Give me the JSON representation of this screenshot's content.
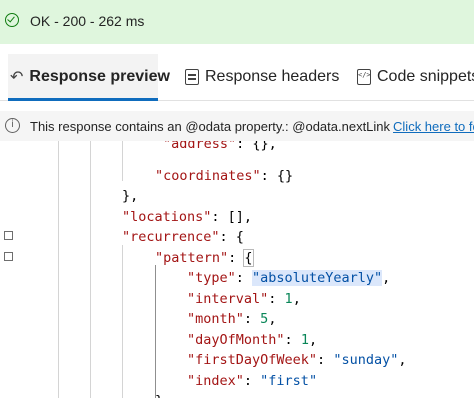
{
  "status": {
    "text": "OK - 200 - 262 ms",
    "color": "#dff6dd"
  },
  "tabs": [
    {
      "label": "Response preview",
      "icon": "undo-arrow-icon",
      "active": true
    },
    {
      "label": "Response headers",
      "icon": "headers-icon",
      "active": false
    },
    {
      "label": "Code snippets",
      "icon": "code-snippet-icon",
      "active": false
    }
  ],
  "info": {
    "text": "This response contains an @odata property.: @odata.nextLink",
    "link": "Click here to fo"
  },
  "code": {
    "l1": [
      "\"address\"",
      ": {},"
    ],
    "l2": [
      "\"coordinates\"",
      ": {}"
    ],
    "l3": "},",
    "l4": [
      "\"locations\"",
      ": [],"
    ],
    "l5": [
      "\"recurrence\"",
      ": {"
    ],
    "l6": [
      "\"pattern\"",
      ": {"
    ],
    "l7": [
      "\"type\"",
      ": ",
      "\"absoluteYearly\"",
      ","
    ],
    "l8": [
      "\"interval\"",
      ": ",
      "1",
      ","
    ],
    "l9": [
      "\"month\"",
      ": ",
      "5",
      ","
    ],
    "l10": [
      "\"dayOfMonth\"",
      ": ",
      "1",
      ","
    ],
    "l11": [
      "\"firstDayOfWeek\"",
      ": ",
      "\"sunday\"",
      ","
    ],
    "l12": [
      "\"index\"",
      ": ",
      "\"first\""
    ],
    "l13": "},"
  },
  "colors": {
    "accent": "#0f6cbd",
    "json_key": "#a31515",
    "json_string": "#0451a5",
    "json_number": "#098658"
  }
}
